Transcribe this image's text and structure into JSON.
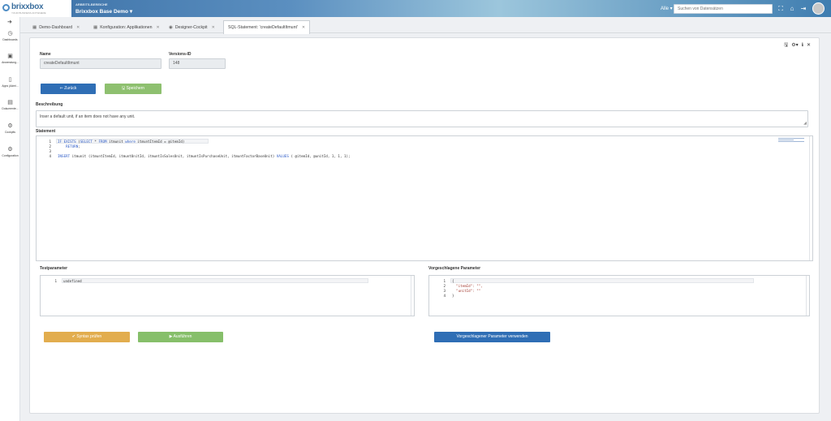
{
  "app": {
    "logo_text": "brixxbox",
    "logo_subtitle": "YOUR BUSINESS ANYWHERE",
    "area_label": "ARBEITS-BEREICHE",
    "area_value": "Brixxbox Base Demo",
    "search_scope": "Alle",
    "search_placeholder": "Suchen von Datensätzen"
  },
  "sidebar": {
    "items": [
      {
        "label": "Dashboards",
        "icon": "dashboard-icon"
      },
      {
        "label": "Anwendung...",
        "icon": "app-box-icon"
      },
      {
        "label": "Apps (Admi...",
        "icon": "book-icon"
      },
      {
        "label": "Dokumente...",
        "icon": "documents-icon"
      },
      {
        "label": "Cockpits",
        "icon": "cockpit-icon"
      },
      {
        "label": "Configuration",
        "icon": "gears-icon"
      }
    ]
  },
  "tabs": [
    {
      "label": "Demo-Dashboard"
    },
    {
      "label": "Konfiguration: Applikationen"
    },
    {
      "label": "Designer-Cockpit"
    },
    {
      "label": "SQL-Statement: 'createDefaultItmunt'"
    }
  ],
  "form": {
    "name_label": "Name",
    "name_value": "createDefaultItmunt",
    "version_label": "Versions-ID",
    "version_value": "148",
    "back_button": "Zurück",
    "save_button": "Speichern",
    "description_label": "Beschreibung",
    "description_value": "Inser a default unit, if an item does not have any unit.",
    "statement_label": "Statement",
    "test_params_label": "Testparameter",
    "suggested_params_label": "Vorgeschlagene Parameter",
    "check_syntax_button": "Syntax prüfen",
    "run_button": "Ausführen",
    "use_params_button": "Vorgeschlagener Parameter verwenden"
  },
  "statement_lines": [
    {
      "n": "1",
      "text": "IF EXISTS (SELECT * FROM itmunit where itmuntItemId = @itemId)"
    },
    {
      "n": "2",
      "text": "    RETURN;"
    },
    {
      "n": "3",
      "text": ""
    },
    {
      "n": "4",
      "text": "INSERT itmunit (itmuntItemId, itmuntUnitId, itmuntIsSalesUnit, itmuntIsPurchaseUnit, itmuntFactorBaseUnit) VALUES ( @itemId, @unitId, 1, 1, 1);"
    }
  ],
  "test_param_lines": [
    {
      "n": "1",
      "text": "undefined"
    }
  ],
  "suggested_param_lines": [
    {
      "n": "1",
      "text": "{"
    },
    {
      "n": "2",
      "text": "  \"itemId\": \"\","
    },
    {
      "n": "3",
      "text": "  \"unitId\": \"\""
    },
    {
      "n": "4",
      "text": "}"
    }
  ]
}
